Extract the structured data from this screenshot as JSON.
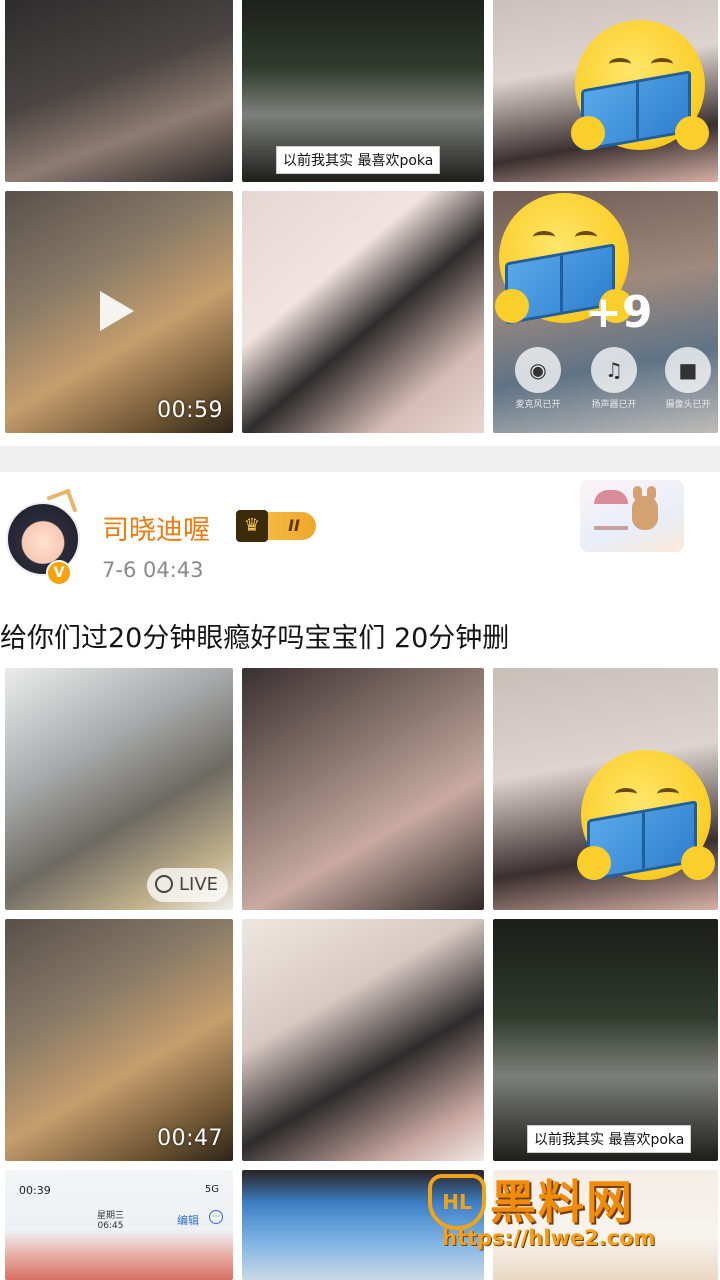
{
  "top_grid": {
    "captions": {
      "poka_caption": "以前我其实 最喜欢poka"
    },
    "video_duration": "00:59",
    "call": {
      "participants_extra": "+9",
      "buttons": [
        {
          "icon": "microphone-icon",
          "label": "麦克风已开"
        },
        {
          "icon": "speaker-icon",
          "label": "扬声器已开"
        },
        {
          "icon": "camera-icon",
          "label": "摄像头已开"
        }
      ]
    }
  },
  "post": {
    "username": "司晓迪喔",
    "vip_level": "II",
    "time": "7-6 04:43",
    "text": "给你们过20分钟眼瘾好吗宝宝们 20分钟删"
  },
  "bottom_grid": {
    "live_label": "LIVE",
    "video_duration": "00:47",
    "poka_caption": "以前我其实 最喜欢poka",
    "phone": {
      "time": "00:39",
      "signal": "5G",
      "weekday": "星期三",
      "weekday_time": "06:45",
      "edit_label": "编辑"
    }
  },
  "watermark": {
    "title": "黑料网",
    "url": "https://hlwe2.com"
  },
  "colors": {
    "username": "#f07a0e",
    "timestamp": "#8a8a8a",
    "separator": "#f0f0f0",
    "watermark": "#f08c0a"
  }
}
